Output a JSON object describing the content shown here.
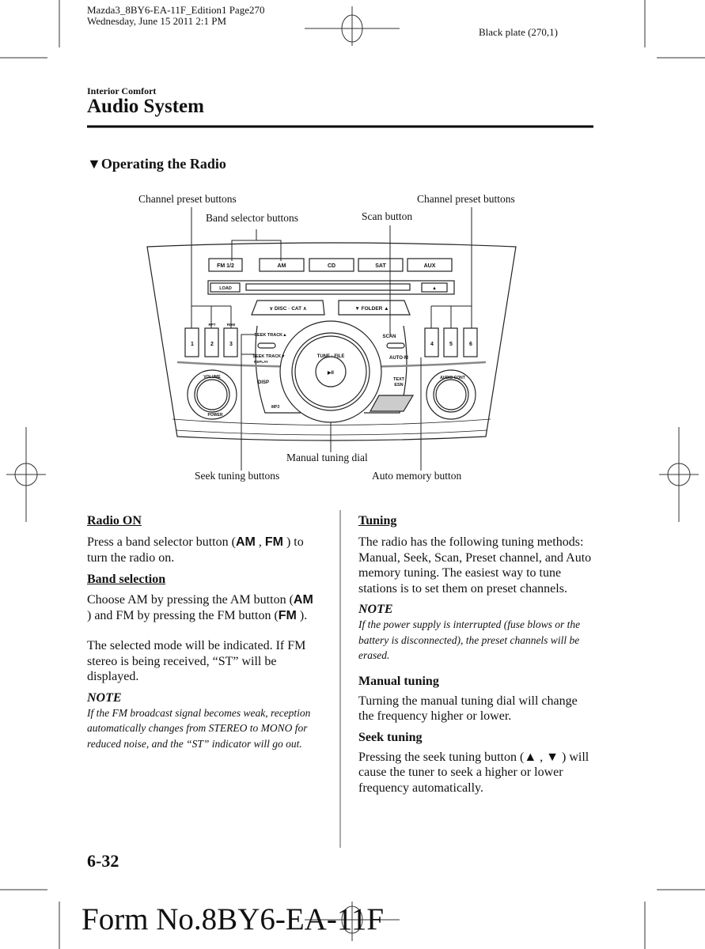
{
  "print_header": {
    "file_line": "Mazda3_8BY6-EA-11F_Edition1 Page270",
    "date_line": "Wednesday, June 15 2011 2:1 PM",
    "plate": "Black plate (270,1)"
  },
  "section": "Interior Comfort",
  "title": "Audio System",
  "subheading": "Operating the Radio",
  "subheading_marker": "▼",
  "diagram": {
    "labels": {
      "channel_preset_left": "Channel preset buttons",
      "band_selector": "Band selector buttons",
      "scan": "Scan button",
      "channel_preset_right": "Channel preset buttons",
      "manual_tuning": "Manual tuning dial",
      "seek_tuning": "Seek tuning buttons",
      "auto_memory": "Auto memory button"
    },
    "faceplate": {
      "band_buttons": [
        "FM 1/2",
        "AM",
        "CD",
        "SAT",
        "AUX"
      ],
      "load": "LOAD",
      "eject": "▲",
      "disc_cat": "∨  DISC · CAT  ∧",
      "folder": "▼   FOLDER   ▲",
      "presets": [
        "1",
        "2",
        "3",
        "4",
        "5",
        "6"
      ],
      "rpt": "RPT",
      "rdm": "RDM",
      "seek_up": "SEEK TRACK▲",
      "seek_down": "SEEK TRACK▼",
      "replay": "REPLAY",
      "scan": "SCAN",
      "auto_m": "AUTO·M",
      "disp": "DISP",
      "text": "TEXT",
      "esn": "ESN",
      "mp3": "MP3",
      "tune_file": "TUNE · FILE",
      "play_pause": "▶II",
      "volume": "VOLUME",
      "power": "POWER",
      "audio_cont": "AUDIO CONT"
    }
  },
  "left_column": {
    "radio_on": {
      "heading": "Radio ON",
      "text_a": "Press a band selector button (",
      "am": "AM",
      "sep": " , ",
      "fm": "FM",
      "text_b": " ) to turn the radio on."
    },
    "band_selection": {
      "heading": "Band selection",
      "text_a": "Choose AM by pressing the AM button (",
      "am": "AM",
      "text_b": " ) and FM by pressing the FM button (",
      "fm": "FM",
      "text_c": " ).",
      "paragraph2": "The selected mode will be indicated. If FM stereo is being received, “ST” will be displayed."
    },
    "note": {
      "label": "NOTE",
      "text": "If the FM broadcast signal becomes weak, reception automatically changes from STEREO to MONO for reduced noise, and the “ST” indicator will go out."
    }
  },
  "right_column": {
    "tuning": {
      "heading": "Tuning",
      "text": "The radio has the following tuning methods: Manual, Seek, Scan, Preset channel, and Auto memory tuning. The easiest way to tune stations is to set them on preset channels."
    },
    "note": {
      "label": "NOTE",
      "text": "If the power supply is interrupted (fuse blows or the battery is disconnected), the preset channels will be erased."
    },
    "manual_tuning": {
      "heading": "Manual tuning",
      "text": "Turning the manual tuning dial will change the frequency higher or lower."
    },
    "seek_tuning": {
      "heading": "Seek tuning",
      "text": "Pressing the seek tuning button (▲ , ▼ ) will cause the tuner to seek a higher or lower frequency automatically."
    }
  },
  "page_number": "6-32",
  "form_number": "Form No.8BY6-EA-11F"
}
